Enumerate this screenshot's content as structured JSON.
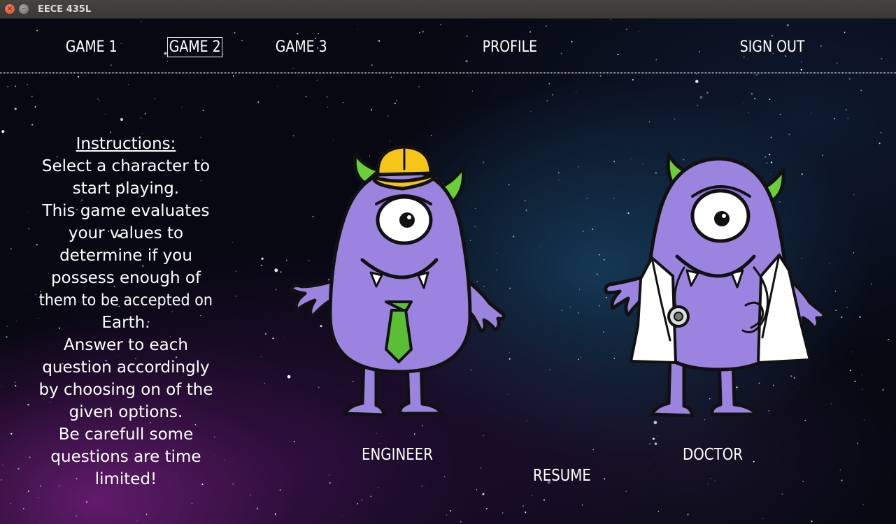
{
  "window": {
    "title": "EECE 435L",
    "close_symbol": "×",
    "minimize_symbol": "–"
  },
  "nav": {
    "items": [
      {
        "label": "GAME 1",
        "active": false
      },
      {
        "label": "GAME 2",
        "active": true
      },
      {
        "label": "GAME 3",
        "active": false
      },
      {
        "label": "PROFILE",
        "active": false
      },
      {
        "label": "SIGN OUT",
        "active": false
      }
    ]
  },
  "instructions": {
    "title": "Instructions:",
    "lines": [
      "Select a character to",
      "start playing.",
      "This game evaluates",
      "your values to",
      "determine if you",
      "possess enough of",
      "them to be accepted on",
      "Earth.",
      "Answer to each",
      "question accordingly",
      "by choosing on of the",
      "given options.",
      "Be carefull some",
      "questions are time",
      "limited!"
    ]
  },
  "characters": {
    "engineer": {
      "label": "ENGINEER",
      "icon": "engineer-monster-icon"
    },
    "doctor": {
      "label": "DOCTOR",
      "icon": "doctor-monster-icon"
    }
  },
  "resume_label": "RESUME",
  "colors": {
    "monster_body": "#9b84e0",
    "monster_outline": "#111111",
    "horn": "#6ccf3a",
    "hard_hat": "#f5c518",
    "tie": "#5bbf35",
    "lab_coat": "#ffffff",
    "text": "#ffffff"
  }
}
